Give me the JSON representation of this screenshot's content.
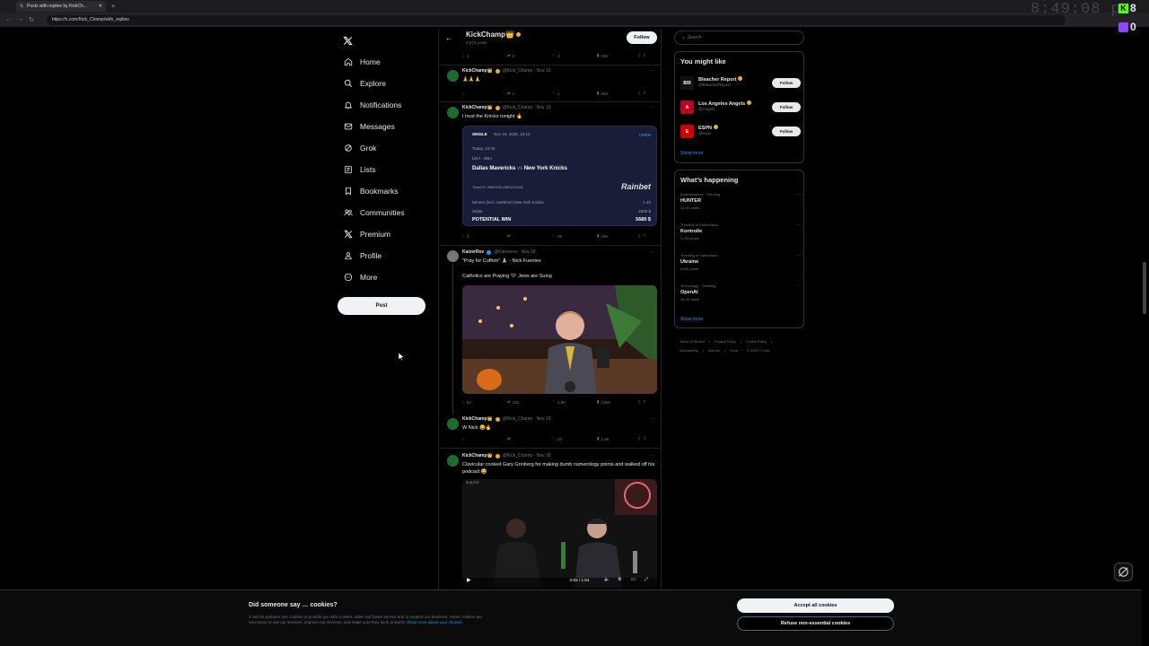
{
  "browser": {
    "tab_title": "Posts with replies by KickCh...",
    "url": "https://x.com/Kick_Champ/with_replies",
    "clock": "8:49:08 pm",
    "kick_count": "8",
    "twitch_count": "0"
  },
  "nav": {
    "items": [
      {
        "label": "Home",
        "icon": "home-icon"
      },
      {
        "label": "Explore",
        "icon": "search-icon"
      },
      {
        "label": "Notifications",
        "icon": "bell-icon"
      },
      {
        "label": "Messages",
        "icon": "mail-icon"
      },
      {
        "label": "Grok",
        "icon": "grok-icon"
      },
      {
        "label": "Lists",
        "icon": "list-icon"
      },
      {
        "label": "Bookmarks",
        "icon": "bookmark-icon"
      },
      {
        "label": "Communities",
        "icon": "people-icon"
      },
      {
        "label": "Premium",
        "icon": "x-icon"
      },
      {
        "label": "Profile",
        "icon": "person-icon"
      },
      {
        "label": "More",
        "icon": "more-circle-icon"
      }
    ],
    "post_label": "Post"
  },
  "header": {
    "name": "KickChamp👑",
    "posts": "4,572 posts",
    "follow_label": "Follow"
  },
  "posts": [
    {
      "actions": {
        "replies": "1",
        "reposts": "2",
        "likes": "3",
        "views": "256"
      }
    },
    {
      "name": "KickChamp👑",
      "handle": "@Kick_Champ · Nov 19",
      "text": "🙏🙏🙏",
      "actions": {
        "replies": "",
        "reposts": "1",
        "likes": "1",
        "views": "258"
      }
    },
    {
      "name": "KickChamp👑",
      "handle": "@Kick_Champ · Nov 19",
      "text": "I trust the Knicks tonight 🔥",
      "actions": {
        "replies": "3",
        "reposts": "",
        "likes": "39",
        "views": "16K"
      }
    },
    {
      "name": "KaizerRev",
      "handle": "@Kaizerrev · Nov 18",
      "text": "\"Pray for Cuffem\" 🙏 - Nick Fuentes",
      "text2": "Catholics are Praying 🖤 Jews are Suing",
      "actions": {
        "replies": "54",
        "reposts": "193",
        "likes": "3.8K",
        "views": "105K"
      }
    },
    {
      "name": "KickChamp👑",
      "handle": "@Kick_Champ · Nov 19",
      "text": "W Nick 😂🔥",
      "actions": {
        "replies": "",
        "reposts": "",
        "likes": "20",
        "views": "1.8K"
      }
    },
    {
      "name": "KickChamp👑",
      "handle": "@Kick_Champ · Nov 18",
      "text": "Clavicular cooked Gary Grinberg for making dumb numerology points and walked off his podcast 😂",
      "video_time": "0:02 / 1:54",
      "video_tag": "✕ 8,717"
    }
  ],
  "betslip": {
    "type": "SINGLE",
    "date": "Nov 19, 2025, 10:12",
    "status": "OPEN",
    "time": "Today, 23:30",
    "league": "USA · NBA",
    "team1": "Dallas Mavericks",
    "vs": "vs",
    "team2": "New York Knicks",
    "ticket": "Ticket ID: 9950325143691123445",
    "brand": "Rainbet",
    "market": "Winner (incl. overtime) New York Knicks",
    "odds": "1.42",
    "stake_label": "Stake",
    "stake": "4000 $",
    "win_label": "POTENTIAL WIN",
    "win": "5680 $"
  },
  "right": {
    "search_placeholder": "Search",
    "you_might_like": "You might like",
    "recs": [
      {
        "name": "Bleacher Report",
        "handle": "@BleacherReport",
        "logo": "B/R",
        "follow": "Follow"
      },
      {
        "name": "Los Angeles Angels",
        "handle": "@Angels",
        "logo": "A",
        "follow": "Follow"
      },
      {
        "name": "ESPN",
        "handle": "@espn",
        "logo": "E",
        "follow": "Follow"
      }
    ],
    "show_more": "Show more",
    "whats_happening": "What’s happening",
    "trends": [
      {
        "context": "Entertainment · Trending",
        "topic": "HUNTER",
        "posts": "41.9K posts"
      },
      {
        "context": "Trending in Switzerland",
        "topic": "Kontrolle",
        "posts": "3,250 posts"
      },
      {
        "context": "Trending in Switzerland",
        "topic": "Ukraine",
        "posts": "533K posts"
      },
      {
        "context": "Technology · Trending",
        "topic": "OpenAI",
        "posts": "35.4K posts"
      }
    ],
    "show_more2": "Show more",
    "footer": [
      "Terms of Service",
      "|",
      "Privacy Policy",
      "|",
      "Cookie Policy",
      "|",
      "Accessibility",
      "|",
      "Ads info",
      "|",
      "More ···",
      "© 2025 X Corp."
    ]
  },
  "cookie": {
    "title": "Did someone say … cookies?",
    "body": "X and its partners use cookies to provide you with a better, safer and faster service and to support our business. Some cookies are necessary to use our services, improve our services, and make sure they work properly.",
    "link": "Show more about your choices.",
    "accept": "Accept all cookies",
    "refuse": "Refuse non-essential cookies"
  }
}
